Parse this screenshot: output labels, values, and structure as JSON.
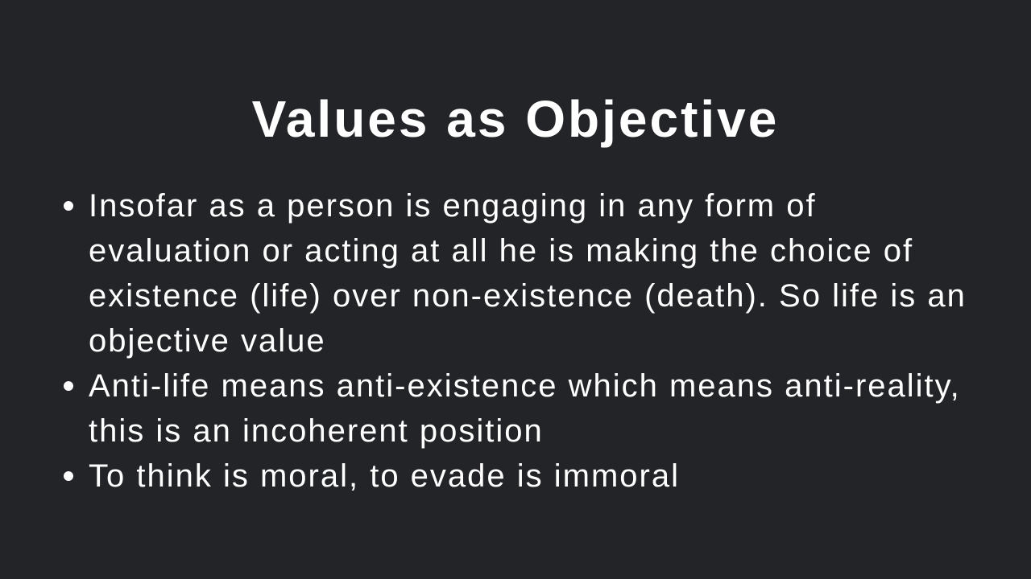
{
  "slide": {
    "title": "Values as Objective",
    "bullets": [
      {
        "text": "Insofar as a person is engaging in any form of evaluation or acting at all he is making the choice of existence (life) over non-existence (death). So life is an objective value"
      },
      {
        "text": "Anti-life means anti-existence which means anti-reality, this is an incoherent position"
      },
      {
        "text": "To think is moral, to evade is immoral"
      }
    ],
    "colors": {
      "background": "#232428",
      "text": "#ffffff"
    }
  }
}
